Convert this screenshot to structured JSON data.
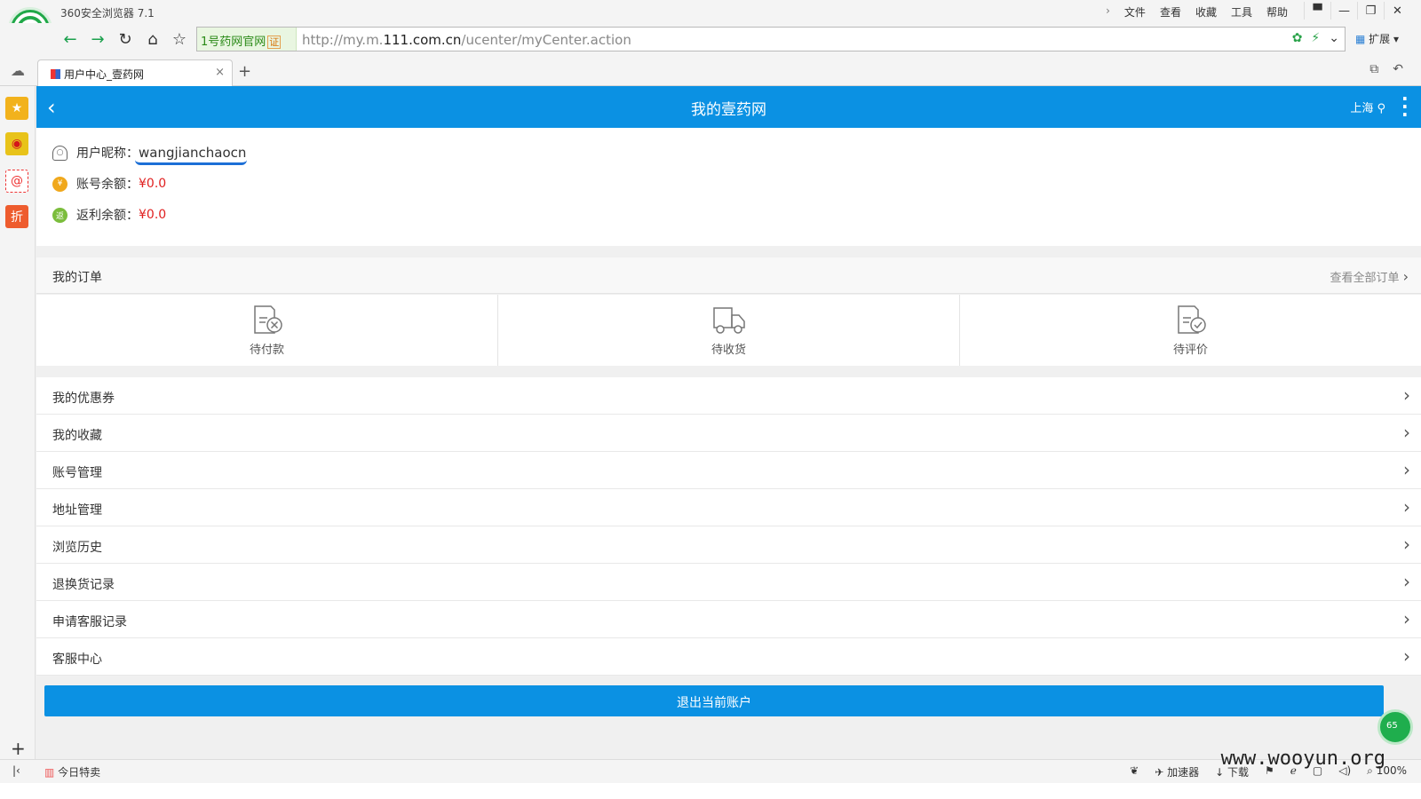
{
  "browser": {
    "title": "360安全浏览器 7.1",
    "menu": [
      "文件",
      "查看",
      "收藏",
      "工具",
      "帮助"
    ],
    "window_controls": [
      "—",
      "❐",
      "✕"
    ],
    "site_badge": "1号药网官网",
    "site_badge_cert": "证",
    "url_prefix": "http://my.m.",
    "url_domain": "111.com.cn",
    "url_path": "/ucenter/myCenter.action",
    "extensions_label": "扩展",
    "tab_title": "用户中心_壹药网",
    "new_tab": "+"
  },
  "page": {
    "header_title": "我的壹药网",
    "city": "上海",
    "user": {
      "nickname_label": "用户昵称：",
      "nickname": "wangjianchaocn",
      "balance_label": "账号余额：",
      "balance": "¥0.0",
      "rebate_label": "返利余额：",
      "rebate": "¥0.0"
    },
    "orders": {
      "title": "我的订单",
      "view_all": "查看全部订单",
      "items": [
        {
          "label": "待付款",
          "icon": "pending-payment-icon"
        },
        {
          "label": "待收货",
          "icon": "truck-icon"
        },
        {
          "label": "待评价",
          "icon": "pending-review-icon"
        }
      ]
    },
    "menu_items": [
      "我的优惠券",
      "我的收藏",
      "账号管理",
      "地址管理",
      "浏览历史",
      "退换货记录",
      "申请客服记录",
      "客服中心"
    ],
    "logout": "退出当前账户",
    "floating_badge": "65"
  },
  "statusbar": {
    "today_deals": "今日特卖",
    "accelerator": "加速器",
    "download": "下载",
    "zoom": "100%"
  },
  "watermark": "www.wooyun.org",
  "colors": {
    "brand_blue": "#0b91e3",
    "price_red": "#e02020",
    "browser_green": "#20a848"
  }
}
